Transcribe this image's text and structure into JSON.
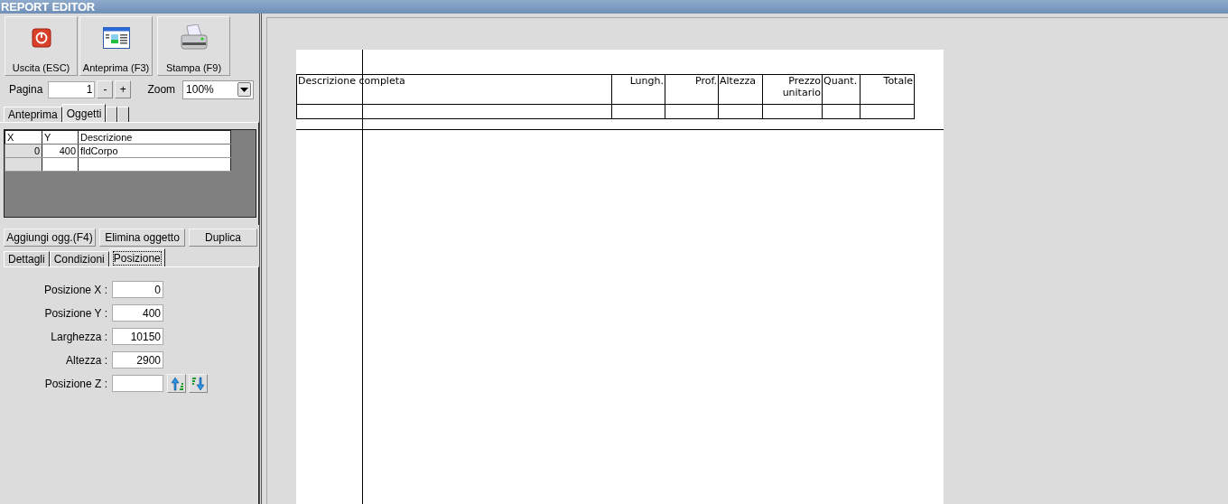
{
  "window": {
    "title": "REPORT EDITOR"
  },
  "toolbar": [
    {
      "label": "Uscita (ESC)",
      "kind": "exit"
    },
    {
      "label": "Anteprima (F3)",
      "kind": "preview"
    },
    {
      "label": "Stampa (F9)",
      "kind": "print"
    }
  ],
  "pager": {
    "label": "Pagina",
    "value": "1",
    "minus": "-",
    "plus": "+",
    "zoom_label": "Zoom",
    "zoom_value": "100%"
  },
  "tabs": [
    {
      "label": "Anteprima",
      "selected": false
    },
    {
      "label": "Oggetti",
      "selected": true
    },
    {
      "selected": false
    },
    {
      "selected": false
    }
  ],
  "objects_table": {
    "columns": [
      "X",
      "Y",
      "Descrizione"
    ],
    "rows": [
      [
        "0",
        "400",
        "fldCorpo"
      ]
    ]
  },
  "object_buttons": [
    "Aggiungi ogg.(F4)",
    "Elimina oggetto",
    "Duplica"
  ],
  "detail_tabs": [
    {
      "label": "Dettagli",
      "selected": false
    },
    {
      "label": "Condizioni",
      "selected": false
    },
    {
      "label": "Posizione",
      "selected": true
    }
  ],
  "position_fields": [
    {
      "label": "Posizione X :",
      "value": "0"
    },
    {
      "label": "Posizione Y :",
      "value": "400"
    },
    {
      "label": "Larghezza :",
      "value": "10150"
    },
    {
      "label": "Altezza :",
      "value": "2900"
    },
    {
      "label": "Posizione Z :",
      "kind": "z"
    }
  ],
  "report": {
    "columns": [
      "Descrizione completa",
      "Lungh.",
      "Prof.",
      "Altezza",
      "Prezzo unitario",
      "Quant.",
      "Totale"
    ]
  }
}
